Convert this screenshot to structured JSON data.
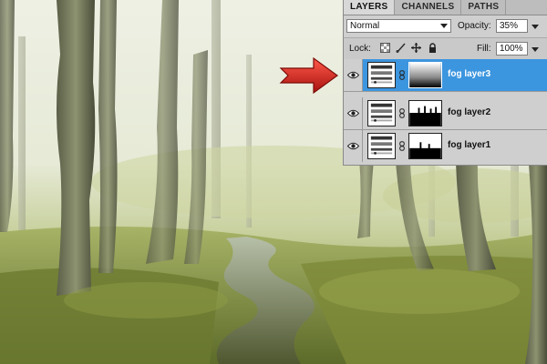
{
  "panel": {
    "tabs": [
      "LAYERS",
      "CHANNELS",
      "PATHS"
    ],
    "active_tab": "LAYERS",
    "blend_mode": "Normal",
    "opacity_label": "Opacity:",
    "opacity_value": "35%",
    "lock_label": "Lock:",
    "fill_label": "Fill:",
    "fill_value": "100%"
  },
  "layers": [
    {
      "name": "fog layer3",
      "selected": true,
      "visible": true
    },
    {
      "name": "fog layer2",
      "selected": false,
      "visible": true
    },
    {
      "name": "fog layer1",
      "selected": false,
      "visible": true
    }
  ],
  "colors": {
    "selection": "#3c95df",
    "arrow": "#d42020",
    "panel_bg": "#cfcfcf"
  },
  "icons": {
    "lock_icons": [
      "lock-transparency-icon",
      "lock-brush-icon",
      "lock-move-icon",
      "lock-all-icon"
    ],
    "layer_icons": [
      "eye-icon",
      "levels-thumbnail-icon",
      "chain-link-icon",
      "layer-mask-icon"
    ]
  }
}
